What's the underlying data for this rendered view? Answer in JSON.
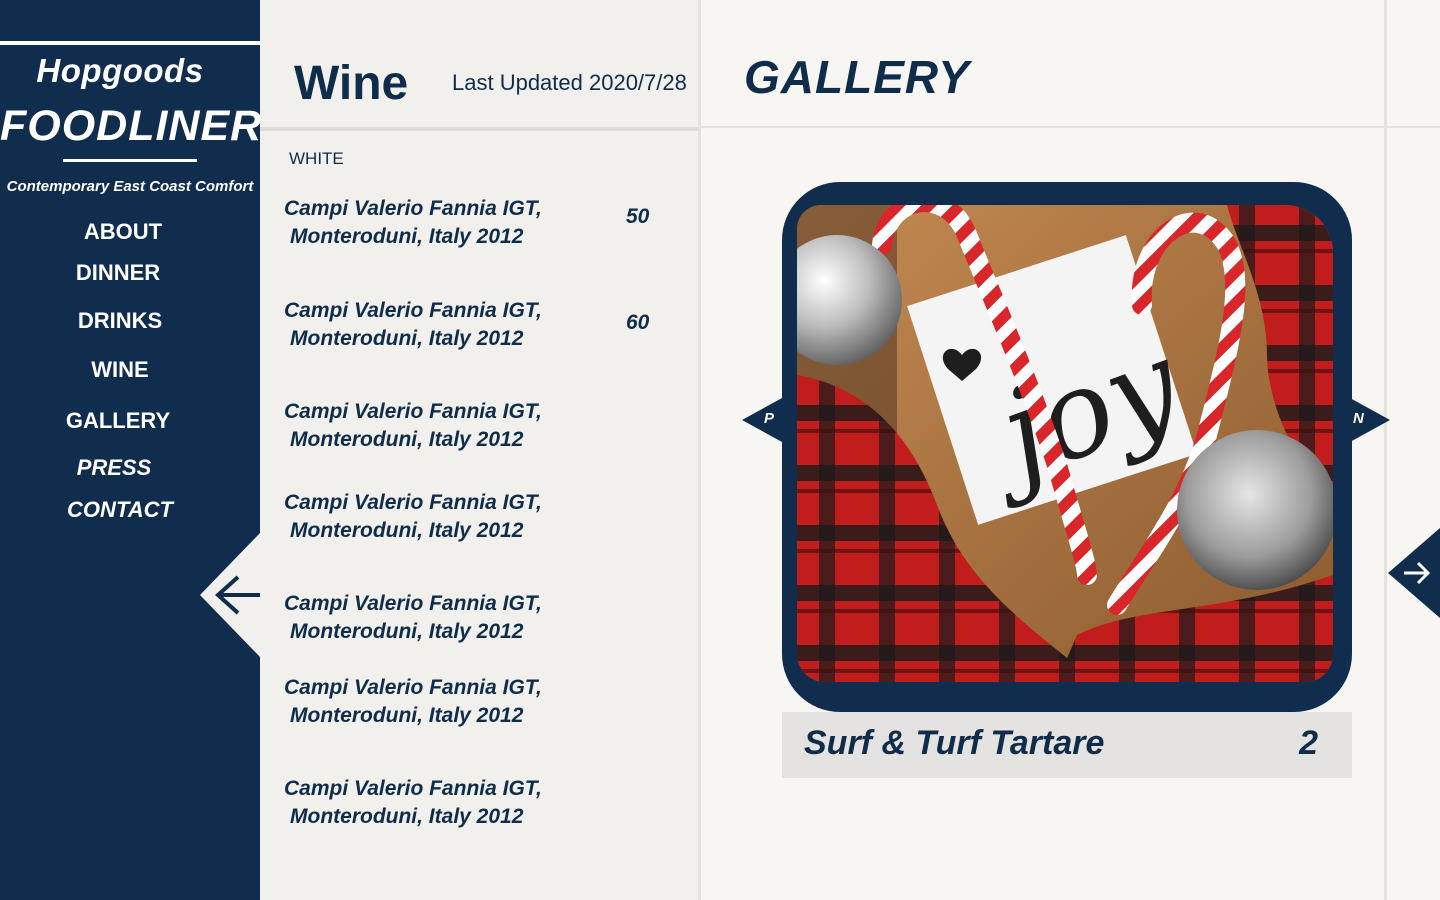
{
  "brand": {
    "name_top": "Hopgoods",
    "name_main": "FOODLINER",
    "tagline": "Contemporary East Coast Comfort"
  },
  "nav": {
    "items": [
      {
        "label": "ABOUT"
      },
      {
        "label": "DINNER"
      },
      {
        "label": "DRINKS"
      },
      {
        "label": "WINE"
      },
      {
        "label": "GALLERY"
      },
      {
        "label": "PRESS"
      },
      {
        "label": "CONTACT"
      }
    ],
    "back_icon": "arrow-left-icon"
  },
  "wine": {
    "title": "Wine",
    "updated": "Last Updated 2020/7/28",
    "section": "WHITE",
    "items": [
      {
        "line1": "Campi Valerio Fannia IGT,",
        "line2": "Monteroduni, Italy 2012",
        "price": "50"
      },
      {
        "line1": "Campi Valerio Fannia IGT,",
        "line2": "Monteroduni, Italy 2012",
        "price": "60"
      },
      {
        "line1": "Campi Valerio Fannia IGT,",
        "line2": "Monteroduni, Italy 2012",
        "price": ""
      },
      {
        "line1": "Campi Valerio Fannia IGT,",
        "line2": "Monteroduni, Italy 2012",
        "price": ""
      },
      {
        "line1": "Campi Valerio Fannia IGT,",
        "line2": "Monteroduni, Italy 2012",
        "price": ""
      },
      {
        "line1": "Campi Valerio Fannia IGT,",
        "line2": "Monteroduni, Italy 2012",
        "price": ""
      },
      {
        "line1": "Campi Valerio Fannia IGT,",
        "line2": "Monteroduni, Italy 2012",
        "price": ""
      }
    ]
  },
  "gallery": {
    "title": "GALLERY",
    "prev_label": "P",
    "next_label": "N",
    "caption": "Surf & Turf Tartare",
    "count": "2",
    "photo_text": "joy",
    "next_icon": "arrow-right-icon"
  },
  "colors": {
    "navy": "#102d4d",
    "background": "#f7f6f3",
    "panel": "#f1f0ec",
    "caption_bg": "#e4e3e1"
  }
}
